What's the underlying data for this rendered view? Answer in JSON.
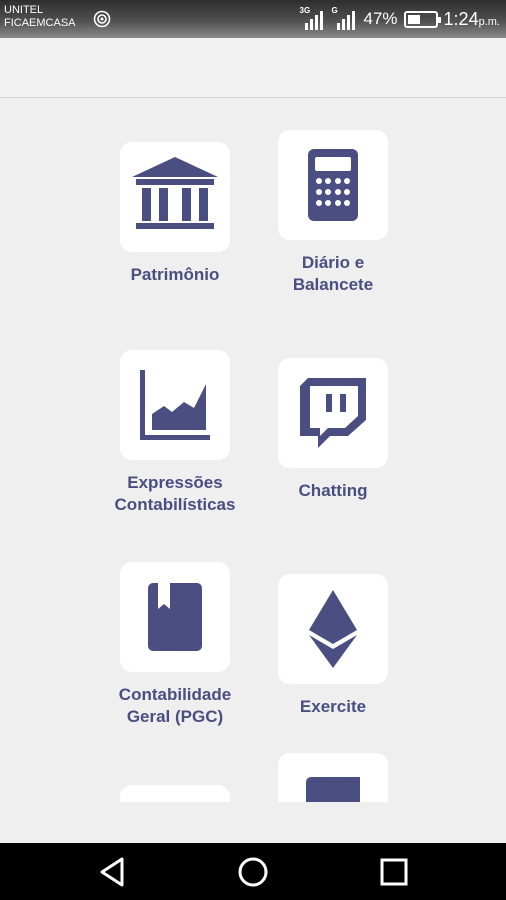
{
  "status_bar": {
    "carrier_line1": "UNITEL",
    "carrier_line2": "FICAEMCASA",
    "network_1": "3G",
    "network_2": "G",
    "battery": "47%",
    "time": "1:24",
    "time_suffix": "p.m."
  },
  "menu": {
    "items": [
      {
        "label": "Patrimônio",
        "icon": "bank-icon"
      },
      {
        "label": "Diário e Balancete",
        "icon": "calculator-icon"
      },
      {
        "label": "Expressões Contabilísticas",
        "icon": "area-chart-icon"
      },
      {
        "label": "Chatting",
        "icon": "chat-icon"
      },
      {
        "label": "Contabilidade Geral (PGC)",
        "icon": "book-icon"
      },
      {
        "label": "Exercite",
        "icon": "ethereum-icon"
      }
    ]
  },
  "nav": {
    "back": "back-icon",
    "home": "home-icon",
    "recents": "recents-icon"
  },
  "colors": {
    "accent": "#4a4e80",
    "tile": "#ffffff",
    "background": "#efefef"
  }
}
